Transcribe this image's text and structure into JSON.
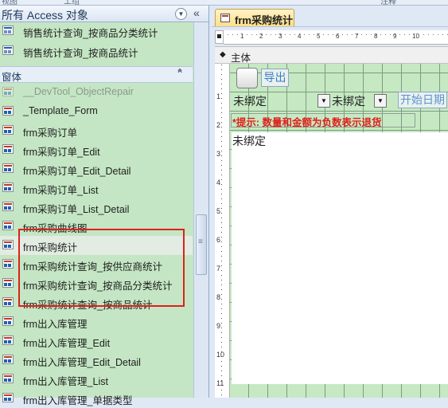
{
  "top_strip": {
    "left": "视图",
    "middle": "工组",
    "right": "注释"
  },
  "nav": {
    "title": "所有 Access 对象",
    "dropdown_glyph": "⊙",
    "collapse_glyph": "«",
    "partial_items": [
      {
        "label": "销售统计查询_按商品分类统计",
        "type": "query"
      },
      {
        "label": "销售统计查询_按商品统计",
        "type": "query"
      }
    ],
    "category": {
      "label": "窗体",
      "chevron": "≈"
    },
    "items": [
      {
        "label": "__DevTool_ObjectRepair",
        "state": "disabled"
      },
      {
        "label": "_Template_Form",
        "state": "normal"
      },
      {
        "label": "frm采购订单",
        "state": "normal"
      },
      {
        "label": "frm采购订单_Edit",
        "state": "normal"
      },
      {
        "label": "frm采购订单_Edit_Detail",
        "state": "normal"
      },
      {
        "label": "frm采购订单_List",
        "state": "normal"
      },
      {
        "label": "frm采购订单_List_Detail",
        "state": "normal"
      },
      {
        "label": "frm采购曲线图",
        "state": "normal"
      },
      {
        "label": "frm采购统计",
        "state": "selected"
      },
      {
        "label": "frm采购统计查询_按供应商统计",
        "state": "normal"
      },
      {
        "label": "frm采购统计查询_按商品分类统计",
        "state": "normal"
      },
      {
        "label": "frm采购统计查询_按商品统计",
        "state": "normal"
      },
      {
        "label": "frm出入库管理",
        "state": "normal"
      },
      {
        "label": "frm出入库管理_Edit",
        "state": "normal"
      },
      {
        "label": "frm出入库管理_Edit_Detail",
        "state": "normal"
      },
      {
        "label": "frm出入库管理_List",
        "state": "normal"
      },
      {
        "label": "frm出入库管理_单据类型",
        "state": "normal"
      }
    ],
    "scroll_grip": "≡"
  },
  "document": {
    "tab_label": "frm采购统计",
    "section_label": "主体",
    "section_glyph": "◆",
    "ruler_h": [
      "1",
      "2",
      "3",
      "4",
      "5",
      "6",
      "7",
      "8",
      "9",
      "10"
    ],
    "ruler_v": [
      "1",
      "2",
      "3",
      "4",
      "5",
      "6",
      "7",
      "8",
      "9",
      "10",
      "11"
    ],
    "export_button": "导出",
    "combo1_value": "未绑定",
    "combo2_value": "未绑定",
    "combo_arrow": "▼",
    "start_date_label": "开始日期",
    "tip": "*提示: 数量和金额为负数表示退货",
    "body_unbound": "未绑定"
  },
  "colors": {
    "nav_bg": "#c4e6c4",
    "form_grid_bg": "#c6e9c4",
    "selection_box": "#e0201a",
    "tip_red": "#e0201a",
    "link_blue": "#3e7cc4"
  }
}
